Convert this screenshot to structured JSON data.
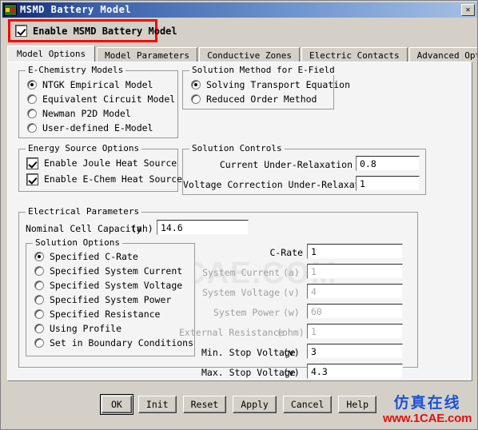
{
  "window": {
    "title": "MSMD Battery Model",
    "close_label": "✕",
    "icon": "battery-app-icon"
  },
  "enable": {
    "label": "Enable MSMD Battery Model",
    "checked": true,
    "highlight_color": "#ff0000"
  },
  "tabs": [
    {
      "label": "Model Options",
      "active": true
    },
    {
      "label": "Model Parameters",
      "active": false
    },
    {
      "label": "Conductive Zones",
      "active": false
    },
    {
      "label": "Electric Contacts",
      "active": false
    },
    {
      "label": "Advanced Option",
      "active": false
    }
  ],
  "echemistry": {
    "legend": "E-Chemistry Models",
    "options": [
      {
        "label": "NTGK Empirical Model",
        "selected": true
      },
      {
        "label": "Equivalent Circuit Model",
        "selected": false
      },
      {
        "label": "Newman P2D Model",
        "selected": false
      },
      {
        "label": "User-defined E-Model",
        "selected": false
      }
    ]
  },
  "efield": {
    "legend": "Solution Method for E-Field",
    "options": [
      {
        "label": "Solving Transport Equation",
        "selected": true
      },
      {
        "label": "Reduced Order Method",
        "selected": false
      }
    ]
  },
  "energy": {
    "legend": "Energy Source Options",
    "options": [
      {
        "label": "Enable Joule Heat Source",
        "checked": true
      },
      {
        "label": "Enable E-Chem Heat Source",
        "checked": true
      }
    ]
  },
  "solution_controls": {
    "legend": "Solution Controls",
    "fields": [
      {
        "label": "Current Under-Relaxation",
        "value": "0.8",
        "enabled": true
      },
      {
        "label": "Voltage Correction Under-Relaxation",
        "value": "1",
        "enabled": true
      }
    ]
  },
  "electrical": {
    "legend": "Electrical Parameters",
    "capacity_label": "Nominal Cell Capacity",
    "capacity_unit": "(ah)",
    "capacity_value": "14.6",
    "solution_options": {
      "legend": "Solution Options",
      "options": [
        {
          "label": "Specified C-Rate",
          "selected": true
        },
        {
          "label": "Specified System Current",
          "selected": false
        },
        {
          "label": "Specified System Voltage",
          "selected": false
        },
        {
          "label": "Specified System Power",
          "selected": false
        },
        {
          "label": "Specified Resistance",
          "selected": false
        },
        {
          "label": "Using Profile",
          "selected": false
        },
        {
          "label": "Set in Boundary Conditions",
          "selected": false
        }
      ]
    },
    "fields": [
      {
        "label": "C-Rate",
        "unit": "",
        "value": "1",
        "enabled": true
      },
      {
        "label": "System Current",
        "unit": "(a)",
        "value": "1",
        "enabled": false
      },
      {
        "label": "System Voltage",
        "unit": "(v)",
        "value": "4",
        "enabled": false
      },
      {
        "label": "System Power",
        "unit": "(w)",
        "value": "60",
        "enabled": false
      },
      {
        "label": "External Resistance",
        "unit": "(ohm)",
        "value": "1",
        "enabled": false
      },
      {
        "label": "Min. Stop Voltage",
        "unit": "(v)",
        "value": "3",
        "enabled": true
      },
      {
        "label": "Max. Stop Voltage",
        "unit": "(v)",
        "value": "4.3",
        "enabled": true
      }
    ]
  },
  "buttons": [
    {
      "label": "OK",
      "default": true
    },
    {
      "label": "Init",
      "default": false
    },
    {
      "label": "Reset",
      "default": false
    },
    {
      "label": "Apply",
      "default": false
    },
    {
      "label": "Cancel",
      "default": false
    },
    {
      "label": "Help",
      "default": false
    }
  ],
  "watermarks": {
    "center": "1CAE.COM",
    "bottom_cn": "仿真在线",
    "bottom_url": "www.1CAE.com"
  }
}
